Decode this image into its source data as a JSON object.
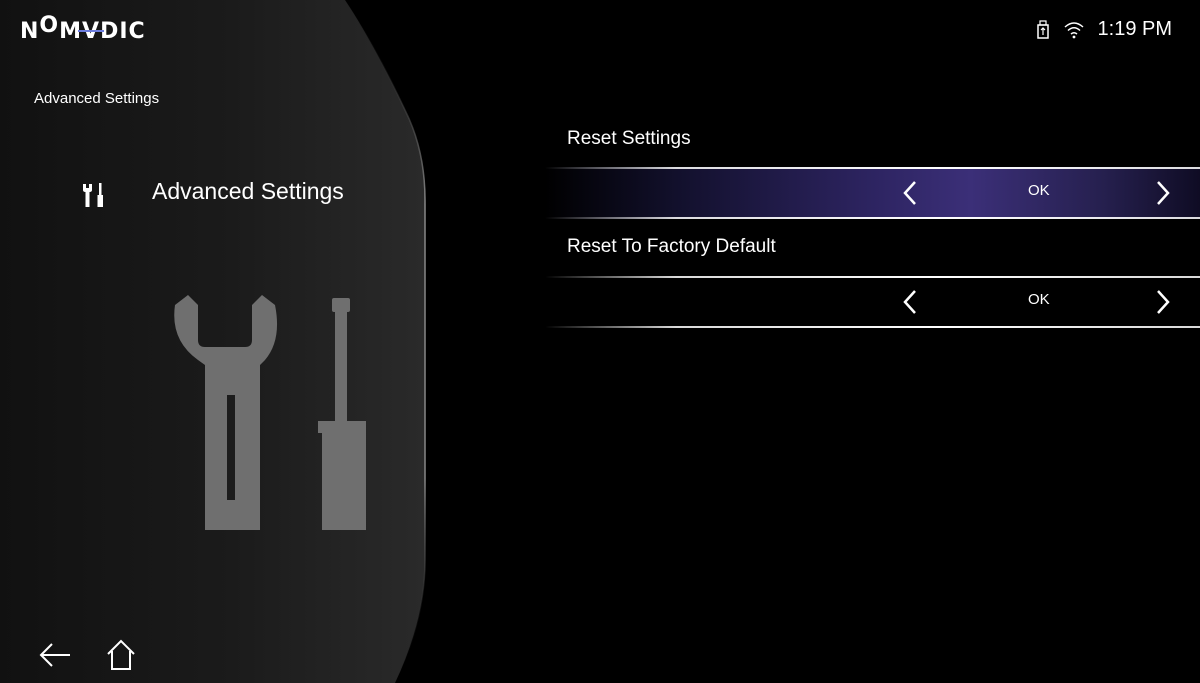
{
  "brand": {
    "logo_text": [
      "N",
      "O",
      "M",
      "V",
      "DIC"
    ]
  },
  "status_bar": {
    "time": "1:19 PM",
    "icons": [
      "usb-storage-icon",
      "wifi-icon"
    ]
  },
  "sidebar": {
    "breadcrumb": "Advanced Settings",
    "section_title": "Advanced Settings",
    "section_icon": "tools-icon",
    "illustration": "wrench-screwdriver-icon"
  },
  "settings": {
    "items": [
      {
        "label": "Reset Settings",
        "value": "OK",
        "focused": true
      },
      {
        "label": "Reset To Factory Default",
        "value": "OK",
        "focused": false
      }
    ]
  },
  "navigation": {
    "back": "back-arrow-icon",
    "home": "home-icon"
  },
  "colors": {
    "accent": "#3b2f78",
    "logo_line": "#6b7bdc",
    "panel": "#1a1a1a"
  }
}
